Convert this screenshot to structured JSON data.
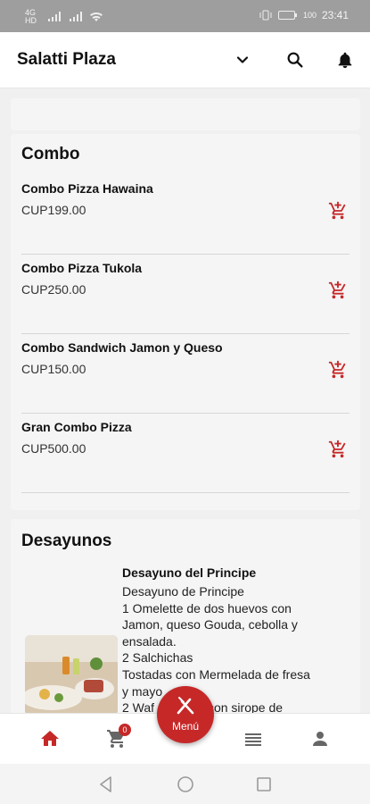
{
  "status_bar": {
    "carrier": "4G HD",
    "battery": "100",
    "time": "23:41"
  },
  "app_bar": {
    "title": "Salatti Plaza"
  },
  "sections": {
    "combo": {
      "title": "Combo",
      "items": [
        {
          "name": "Combo Pizza Hawaina",
          "price": "CUP199.00"
        },
        {
          "name": "Combo Pizza Tukola",
          "price": "CUP250.00"
        },
        {
          "name": "Combo Sandwich Jamon y Queso",
          "price": "CUP150.00"
        },
        {
          "name": "Gran Combo Pizza",
          "price": "CUP500.00"
        }
      ]
    },
    "desayunos": {
      "title": "Desayunos",
      "item": {
        "name": "Desayuno del Principe",
        "description_lines": [
          "Desayuno de Principe",
          "1 Omelette de dos huevos con",
          "Jamon, queso Gouda, cebolla y",
          "ensalada.",
          "2 Salchichas",
          "Tostadas con Mermelada de fresa",
          "y mayo",
          "2 Waf        minosos con sirope de"
        ]
      }
    }
  },
  "bottom_nav": {
    "cart_badge": "0",
    "fab_label": "Menú"
  },
  "colors": {
    "accent": "#c62828",
    "card_bg": "#f5f5f5",
    "page_bg": "#f0f0f0"
  }
}
